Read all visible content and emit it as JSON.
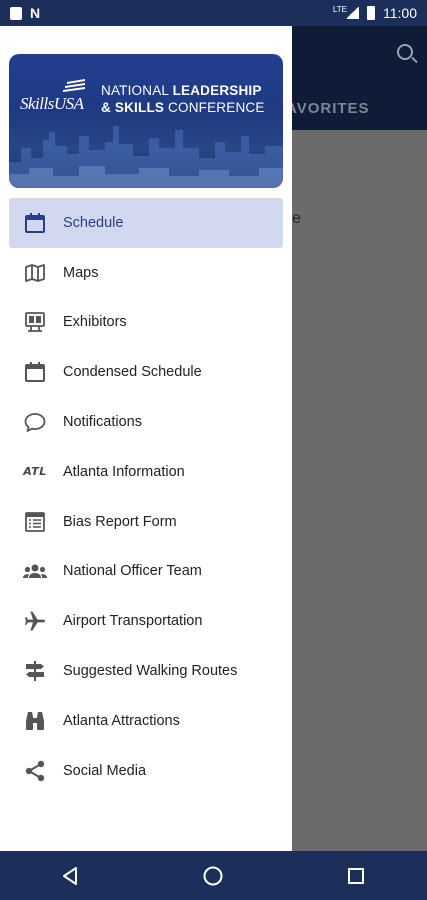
{
  "status_bar": {
    "network_label": "LTE",
    "time": "11:00"
  },
  "banner": {
    "brand": "SkillsUSA",
    "title_line1_light": "NATIONAL ",
    "title_line1_bold": "LEADERSHIP",
    "title_line2_bold": "& SKILLS",
    "title_line2_light": " CONFERENCE"
  },
  "app": {
    "tab_fragment": "AVORITES",
    "body_fragment": "e"
  },
  "menu": {
    "items": [
      {
        "label": "Schedule",
        "icon": "calendar-icon",
        "selected": true
      },
      {
        "label": "Maps",
        "icon": "map-icon"
      },
      {
        "label": "Exhibitors",
        "icon": "exhibitor-booth-icon"
      },
      {
        "label": "Condensed Schedule",
        "icon": "calendar-icon"
      },
      {
        "label": "Notifications",
        "icon": "chat-bubble-icon"
      },
      {
        "label": "Atlanta Information",
        "icon": "atl-text-icon",
        "icon_text": "ATL"
      },
      {
        "label": "Bias Report Form",
        "icon": "form-icon"
      },
      {
        "label": "National Officer Team",
        "icon": "group-icon"
      },
      {
        "label": "Airport Transportation",
        "icon": "airplane-icon"
      },
      {
        "label": "Suggested Walking Routes",
        "icon": "signpost-icon"
      },
      {
        "label": "Atlanta Attractions",
        "icon": "binoculars-icon"
      },
      {
        "label": "Social Media",
        "icon": "share-icon"
      }
    ]
  },
  "colors": {
    "accent": "#2b3e88",
    "selected_bg": "#d1d8f0",
    "status_bar": "#1b2f5a",
    "icon": "#555555"
  }
}
